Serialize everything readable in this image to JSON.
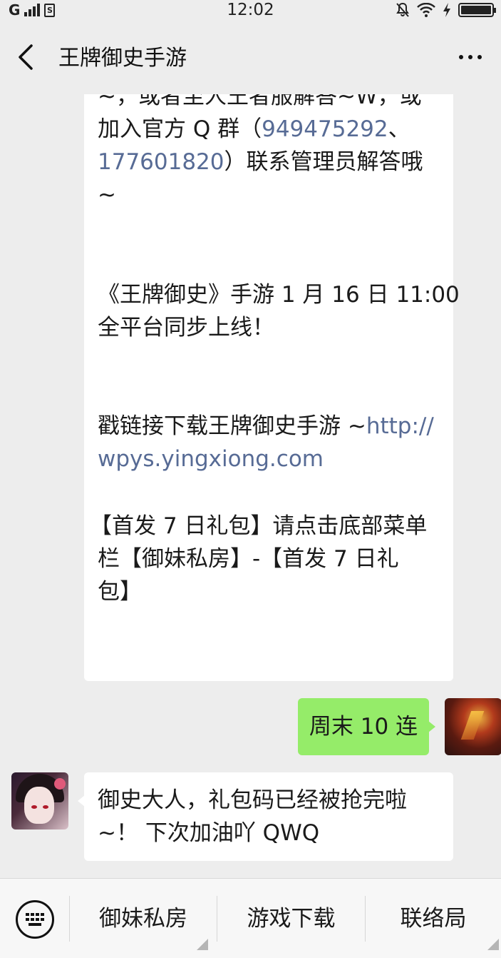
{
  "status_bar": {
    "carrier": "G",
    "sim_label": "S",
    "time": "12:02"
  },
  "header": {
    "title": "王牌御史手游"
  },
  "messages": {
    "article_lines": [
      {
        "segments": [
          {
            "text": "~，或者至人王者服解答~W，或",
            "link": false
          }
        ]
      },
      {
        "segments": [
          {
            "text": "加入官方 Q 群（",
            "link": false
          },
          {
            "text": "949475292",
            "link": true
          },
          {
            "text": "、",
            "link": false
          }
        ]
      },
      {
        "segments": [
          {
            "text": "177601820",
            "link": true
          },
          {
            "text": "）联系管理员解答哦",
            "link": false
          }
        ]
      },
      {
        "segments": [
          {
            "text": "~",
            "link": false
          }
        ]
      },
      {
        "segments": [
          {
            "text": "《王牌御史》手游 1 月 16 日 11:00",
            "link": false
          }
        ]
      },
      {
        "segments": [
          {
            "text": "全平台同步上线！",
            "link": false
          }
        ]
      },
      {
        "segments": [
          {
            "text": "戳链接下载王牌御史手游 ~",
            "link": false
          },
          {
            "text": "http://",
            "link": true
          }
        ]
      },
      {
        "segments": [
          {
            "text": "wpys.yingxiong.com",
            "link": true
          }
        ]
      },
      {
        "segments": [
          {
            "text": "【首发 7 日礼包】请点击底部菜单",
            "link": false
          }
        ]
      },
      {
        "segments": [
          {
            "text": "栏【御妹私房】-【首发 7 日礼",
            "link": false
          }
        ]
      },
      {
        "segments": [
          {
            "text": "包】",
            "link": false
          }
        ]
      }
    ],
    "sent": "周末 10 连",
    "reply_lines": [
      "御史大人，礼包码已经被抢完啦",
      "~！ 下次加油吖 QWQ"
    ]
  },
  "bottom_menu": {
    "items": [
      "御妹私房",
      "游戏下载",
      "联络局"
    ]
  }
}
